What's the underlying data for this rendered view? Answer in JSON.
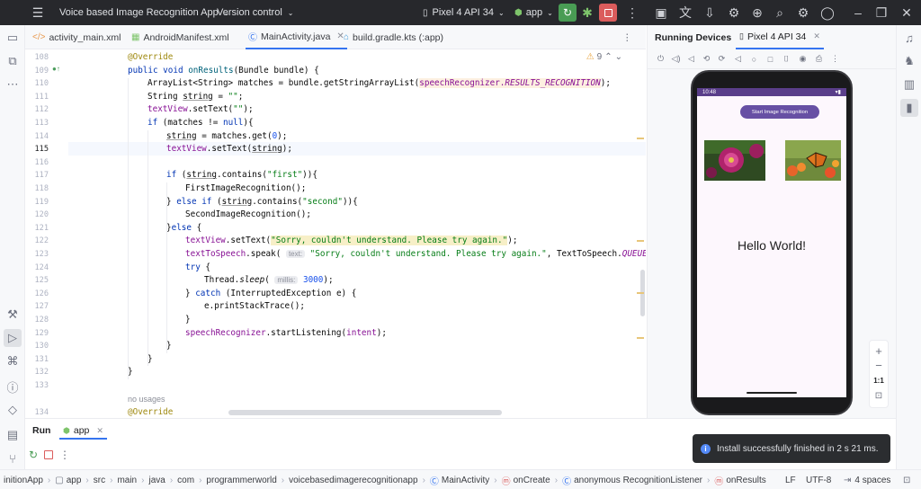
{
  "titlebar": {
    "project_name": "Voice based Image Recognition App",
    "vcs": "Version control",
    "device": "Pixel 4 API 34",
    "run_config": "app"
  },
  "tabs": [
    {
      "label": "activity_main.xml",
      "icon": "xml-file-icon"
    },
    {
      "label": "AndroidManifest.xml",
      "icon": "manifest-file-icon"
    },
    {
      "label": "MainActivity.java",
      "icon": "java-class-icon",
      "active": true
    },
    {
      "label": "build.gradle.kts (:app)",
      "icon": "gradle-file-icon"
    }
  ],
  "editor": {
    "warnings_count": "9",
    "line_numbers": [
      "108",
      "109",
      "110",
      "111",
      "112",
      "113",
      "114",
      "115",
      "116",
      "117",
      "118",
      "119",
      "120",
      "121",
      "122",
      "123",
      "124",
      "125",
      "126",
      "127",
      "128",
      "129",
      "130",
      "131",
      "132",
      "133",
      "",
      "134"
    ],
    "code": {
      "l108": "@Override",
      "l109_kw": "public void",
      "l109_name": "onResults",
      "l109_rest": "(Bundle bundle) {",
      "l110_a": "ArrayList<String> matches = bundle.getStringArrayList(",
      "l110_b": "speechRecognizer.",
      "l110_c": "RESULTS_RECOGNITION",
      "l110_d": ");",
      "l111_a": "String ",
      "l111_b": "string",
      "l111_c": " = ",
      "l111_d": "\"\"",
      "l111_e": ";",
      "l112_a": "textView",
      "l112_b": ".setText(",
      "l112_c": "\"\"",
      "l112_d": ");",
      "l113_a": "if",
      "l113_b": " (matches != ",
      "l113_c": "null",
      "l113_d": "){",
      "l114_a": "string",
      "l114_b": " = matches.get(",
      "l114_c": "0",
      "l114_d": ");",
      "l115_a": "textView",
      "l115_b": ".setText(",
      "l115_c": "string",
      "l115_d": ");",
      "l117_a": "if",
      "l117_b": " (",
      "l117_c": "string",
      "l117_d": ".contains(",
      "l117_e": "\"first\"",
      "l117_f": ")){",
      "l118": "FirstImageRecognition();",
      "l119_a": "} ",
      "l119_b": "else if",
      "l119_c": " (",
      "l119_d": "string",
      "l119_e": ".contains(",
      "l119_f": "\"second\"",
      "l119_g": ")){",
      "l120": "SecondImageRecognition();",
      "l121_a": "}",
      "l121_b": "else",
      "l121_c": " {",
      "l122_a": "textView",
      "l122_b": ".setText(",
      "l122_c": "\"Sorry, couldn't understand. Please try again.\"",
      "l122_d": ");",
      "l123_a": "textToSpeech",
      "l123_b": ".speak( ",
      "l123_hint": "text:",
      "l123_c": " \"Sorry, couldn't understand. Please try again.\"",
      "l123_d": ", TextToSpeech.",
      "l123_e": "QUEUE_FLUS",
      "l124": "try",
      "l124_b": " {",
      "l125_a": "Thread.",
      "l125_b": "sleep",
      "l125_c": "( ",
      "l125_hint": "millis:",
      "l125_d": " 3000",
      "l125_e": ");",
      "l126_a": "} ",
      "l126_b": "catch",
      "l126_c": " (InterruptedException e) {",
      "l127": "e.printStackTrace();",
      "l128": "}",
      "l129_a": "speechRecognizer",
      "l129_b": ".startListening(",
      "l129_c": "intent",
      "l129_d": ");",
      "l130": "}",
      "l131": "}",
      "l132": "}",
      "usages": "no usages",
      "l134": "@Override"
    }
  },
  "devices": {
    "title": "Running Devices",
    "device_tab": "Pixel 4 API 34",
    "phone": {
      "time": "10:48",
      "button_label": "Start Image Recognition",
      "hello": "Hello World!"
    },
    "zoom": {
      "plus": "+",
      "minus": "−",
      "ratio": "1:1"
    }
  },
  "run": {
    "title": "Run",
    "tab": "app"
  },
  "toast": {
    "message": "Install successfully finished in 2 s 21 ms."
  },
  "statusbar": {
    "breadcrumbs": [
      "initionApp",
      "app",
      "src",
      "main",
      "java",
      "com",
      "programmerworld",
      "voicebasedimagerecognitionapp",
      "MainActivity",
      "onCreate",
      "anonymous RecognitionListener",
      "onResults"
    ],
    "line_sep": "LF",
    "encoding": "UTF-8",
    "indent": "4 spaces"
  },
  "colors": {
    "run_green": "#499c54",
    "stop_red": "#db5c5c",
    "accent_blue": "#3574f0",
    "app_purple": "#6750a4"
  }
}
